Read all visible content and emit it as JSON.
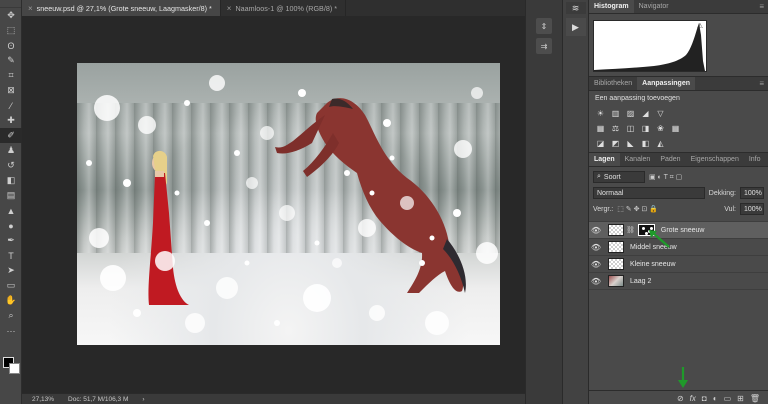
{
  "document_tabs": [
    {
      "label": "sneeuw.psd @ 27,1% (Grote sneeuw, Laagmasker/8) *",
      "close": "×"
    },
    {
      "label": "Naamloos-1 @ 100% (RGB/8) *",
      "close": "×"
    }
  ],
  "toolbar": {
    "tools": [
      {
        "name": "move-tool-icon",
        "glyph": "✥"
      },
      {
        "name": "marquee-tool-icon",
        "glyph": "⬚"
      },
      {
        "name": "lasso-tool-icon",
        "glyph": "ʘ"
      },
      {
        "name": "quick-select-icon",
        "glyph": "✎"
      },
      {
        "name": "crop-tool-icon",
        "glyph": "⌗"
      },
      {
        "name": "frame-tool-icon",
        "glyph": "⊠"
      },
      {
        "name": "eyedropper-icon",
        "glyph": "⁄"
      },
      {
        "name": "healing-brush-icon",
        "glyph": "✚"
      },
      {
        "name": "brush-tool-icon",
        "glyph": "✐"
      },
      {
        "name": "clone-stamp-icon",
        "glyph": "♟"
      },
      {
        "name": "history-brush-icon",
        "glyph": "↺"
      },
      {
        "name": "eraser-icon",
        "glyph": "◧"
      },
      {
        "name": "gradient-icon",
        "glyph": "▤"
      },
      {
        "name": "blur-icon",
        "glyph": "▲"
      },
      {
        "name": "dodge-icon",
        "glyph": "●"
      },
      {
        "name": "pen-tool-icon",
        "glyph": "✒"
      },
      {
        "name": "type-tool-icon",
        "glyph": "T"
      },
      {
        "name": "path-select-icon",
        "glyph": "➤"
      },
      {
        "name": "rectangle-tool-icon",
        "glyph": "▭"
      },
      {
        "name": "hand-tool-icon",
        "glyph": "✋"
      },
      {
        "name": "zoom-tool-icon",
        "glyph": "⌕"
      },
      {
        "name": "more-tools-icon",
        "glyph": "···"
      }
    ]
  },
  "mini_strip": {
    "buttons": [
      "⇕",
      "⇉"
    ]
  },
  "play_strip": {
    "buttons": [
      "≋",
      "▶"
    ]
  },
  "histogram_panel": {
    "tabs": [
      {
        "label": "Histogram",
        "active": true
      },
      {
        "label": "Navigator",
        "active": false
      }
    ],
    "menu": "≡",
    "warning": "⚠"
  },
  "adjust_panel": {
    "tabs": [
      {
        "label": "Bibliotheken",
        "active": false
      },
      {
        "label": "Aanpassingen",
        "active": true
      }
    ],
    "title": "Een aanpassing toevoegen",
    "rows": [
      [
        "☀",
        "▥",
        "▨",
        "◢",
        "▽"
      ],
      [
        "▦",
        "⚖",
        "◫",
        "◨",
        "❀",
        "▦"
      ],
      [
        "◪",
        "◩",
        "◣",
        "◧",
        "◭"
      ]
    ]
  },
  "layers_panel": {
    "tabs": [
      {
        "label": "Lagen",
        "active": true
      },
      {
        "label": "Kanalen",
        "active": false
      },
      {
        "label": "Paden",
        "active": false
      },
      {
        "label": "Eigenschappen",
        "active": false
      },
      {
        "label": "Info",
        "active": false
      }
    ],
    "filter_label": "Soort",
    "blend_mode": "Normaal",
    "opacity_label": "Dekking:",
    "opacity_value": "100%",
    "lock_label": "Vergr.:",
    "fill_label": "Vul:",
    "fill_value": "100%",
    "layers": [
      {
        "name": "Grote sneeuw",
        "selected": true,
        "mask": true,
        "thumb": "transparent"
      },
      {
        "name": "Middel sneeuw",
        "selected": false,
        "mask": false,
        "thumb": "transparent"
      },
      {
        "name": "Kleine sneeuw",
        "selected": false,
        "mask": false,
        "thumb": "transparent"
      },
      {
        "name": "Laag 2",
        "selected": false,
        "mask": false,
        "thumb": "photo"
      }
    ],
    "bottom_icons": [
      "⊘",
      "fx",
      "◘",
      "◐",
      "▭",
      "⊞",
      "🗑"
    ]
  },
  "statusbar": {
    "zoom": "27,13%",
    "doc": "Doc: 51,7 M/106,3 M",
    "arrow": "›"
  },
  "colors": {
    "accent_green": "#1f9a2a",
    "horse": "#8a3530",
    "dress": "#c01a22"
  }
}
